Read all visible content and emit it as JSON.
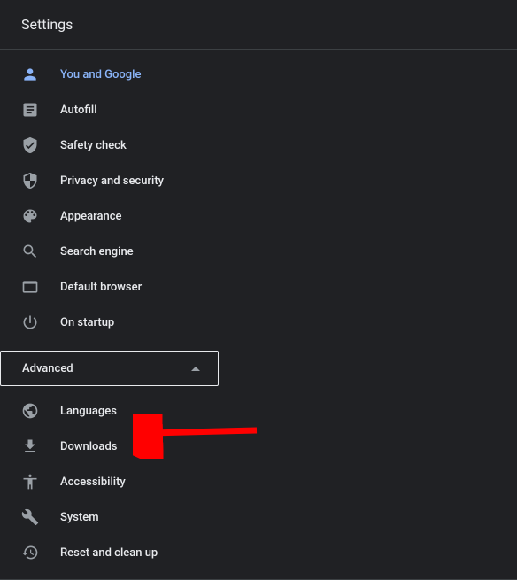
{
  "header": {
    "title": "Settings"
  },
  "nav": {
    "items": [
      {
        "id": "you-and-google",
        "label": "You and Google",
        "selected": true
      },
      {
        "id": "autofill",
        "label": "Autofill"
      },
      {
        "id": "safety-check",
        "label": "Safety check"
      },
      {
        "id": "privacy-security",
        "label": "Privacy and security"
      },
      {
        "id": "appearance",
        "label": "Appearance"
      },
      {
        "id": "search-engine",
        "label": "Search engine"
      },
      {
        "id": "default-browser",
        "label": "Default browser"
      },
      {
        "id": "on-startup",
        "label": "On startup"
      }
    ]
  },
  "advanced": {
    "label": "Advanced",
    "expanded": true,
    "items": [
      {
        "id": "languages",
        "label": "Languages"
      },
      {
        "id": "downloads",
        "label": "Downloads"
      },
      {
        "id": "accessibility",
        "label": "Accessibility"
      },
      {
        "id": "system",
        "label": "System"
      },
      {
        "id": "reset",
        "label": "Reset and clean up"
      }
    ]
  },
  "annotation": {
    "arrow_target": "downloads",
    "arrow_color": "#ff0000"
  }
}
